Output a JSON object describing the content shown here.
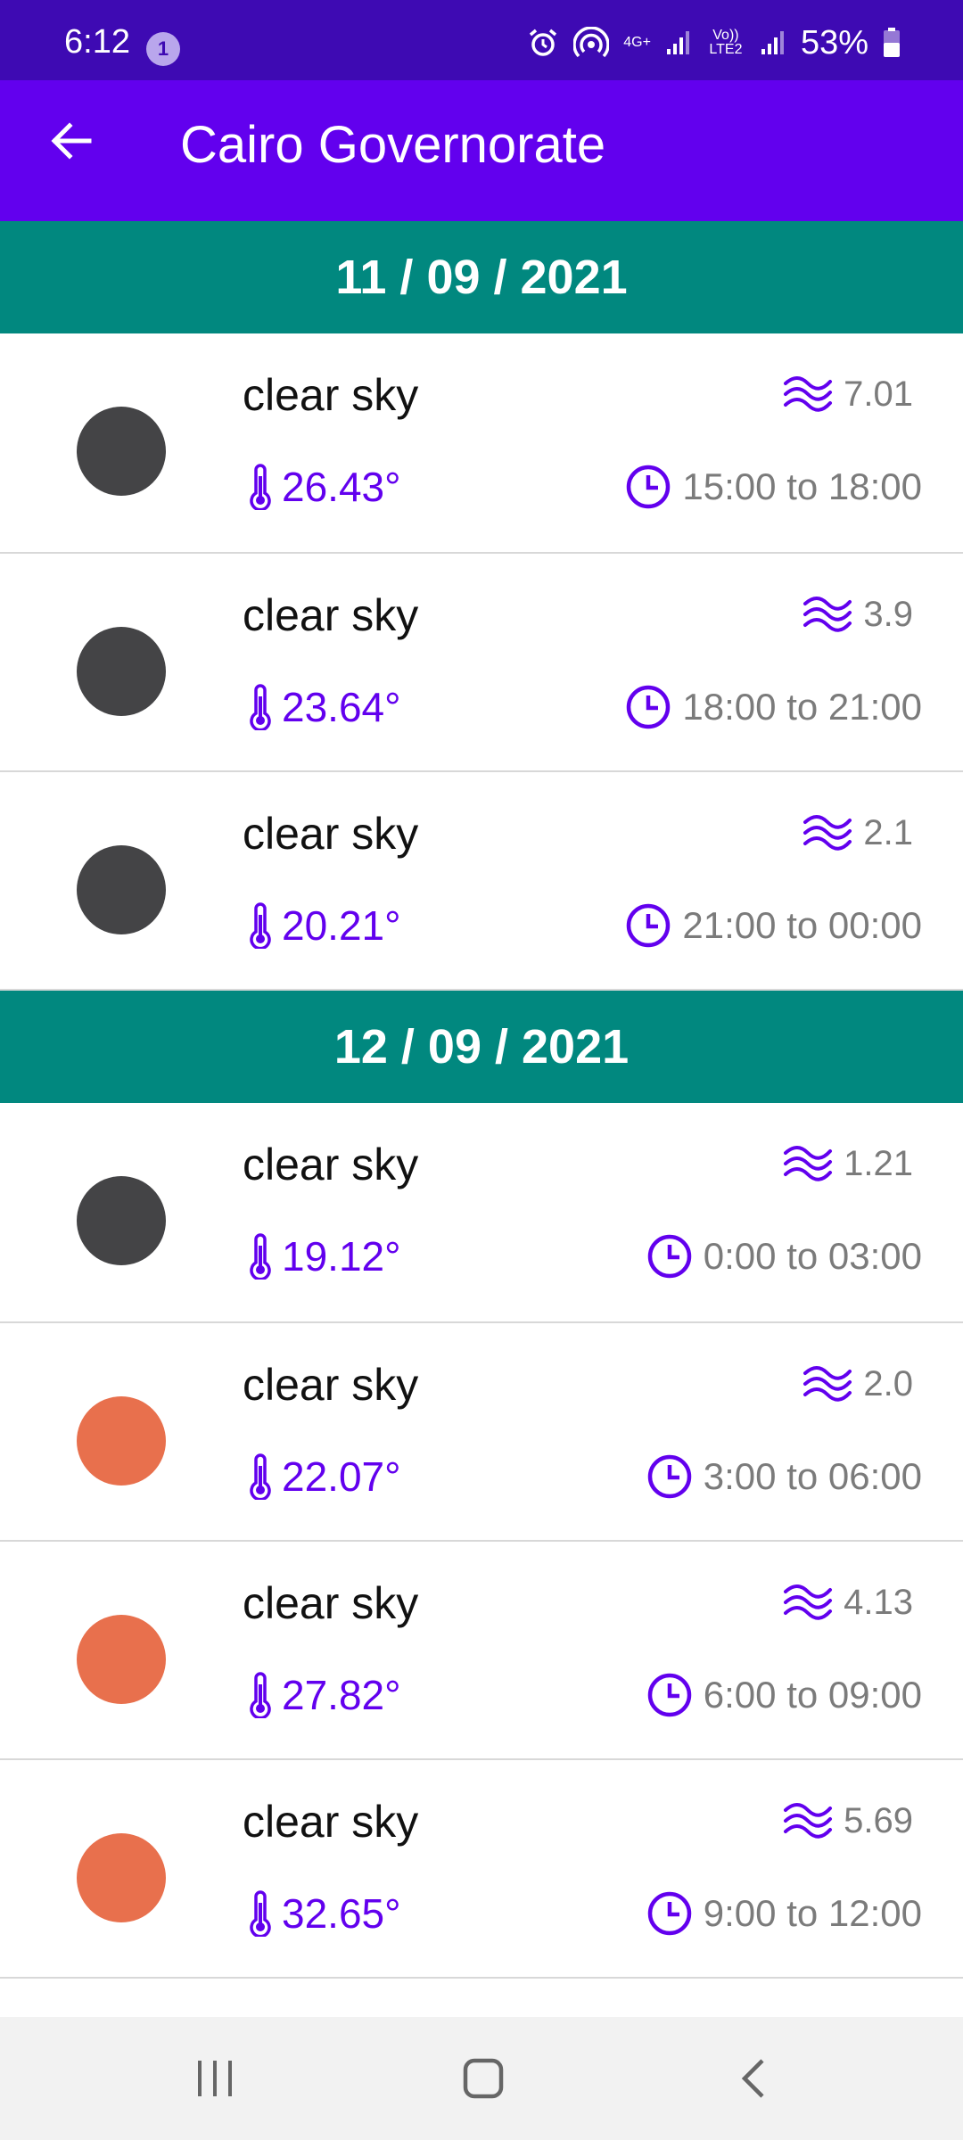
{
  "status_bar": {
    "time": "6:12",
    "notification_count": "1",
    "network_1": "4G+",
    "network_2": "Vo)) LTE2",
    "battery": "53%",
    "icons": [
      "alarm-icon",
      "hotspot-icon",
      "signal-icon",
      "signal-icon",
      "battery-icon"
    ]
  },
  "app_bar": {
    "title": "Cairo Governorate",
    "back_icon": "arrow-back-icon"
  },
  "colors": {
    "status_bar": "#3e0ab3",
    "app_bar": "#6200ee",
    "date_header": "#01887f",
    "accent": "#6200ee",
    "night_dot": "#444446",
    "day_dot": "#e8704d"
  },
  "days": [
    {
      "date": "11 / 09 / 2021",
      "items": [
        {
          "description": "clear sky",
          "wind": "7.01",
          "temp": "26.43°",
          "time": "15:00 to 18:00",
          "dot": "night"
        },
        {
          "description": "clear sky",
          "wind": "3.9",
          "temp": "23.64°",
          "time": "18:00 to 21:00",
          "dot": "night"
        },
        {
          "description": "clear sky",
          "wind": "2.1",
          "temp": "20.21°",
          "time": "21:00 to 00:00",
          "dot": "night"
        }
      ]
    },
    {
      "date": "12 / 09 / 2021",
      "items": [
        {
          "description": "clear sky",
          "wind": "1.21",
          "temp": "19.12°",
          "time": "0:00 to 03:00",
          "dot": "night"
        },
        {
          "description": "clear sky",
          "wind": "2.0",
          "temp": "22.07°",
          "time": "3:00 to 06:00",
          "dot": "day"
        },
        {
          "description": "clear sky",
          "wind": "4.13",
          "temp": "27.82°",
          "time": "6:00 to 09:00",
          "dot": "day"
        },
        {
          "description": "clear sky",
          "wind": "5.69",
          "temp": "32.65°",
          "time": "9:00 to 12:00",
          "dot": "day"
        }
      ]
    }
  ],
  "nav_bar": {
    "buttons": [
      "recents-icon",
      "home-icon",
      "back-icon"
    ]
  }
}
